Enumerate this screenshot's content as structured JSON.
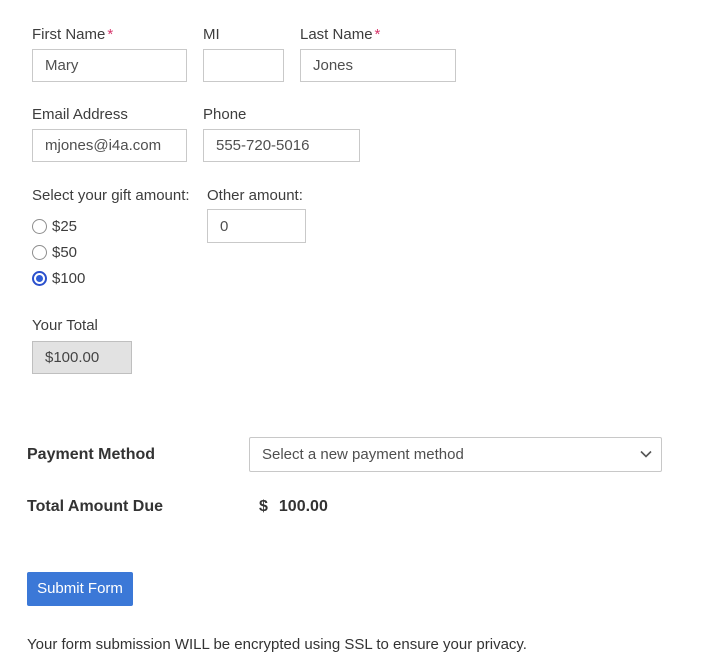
{
  "form": {
    "fields": {
      "first_name": {
        "label": "First Name",
        "required_marker": "*",
        "value": "Mary"
      },
      "mi": {
        "label": "MI",
        "value": ""
      },
      "last_name": {
        "label": "Last Name",
        "required_marker": "*",
        "value": "Jones"
      },
      "email": {
        "label": "Email Address",
        "value": "mjones@i4a.com"
      },
      "phone": {
        "label": "Phone",
        "value": "555-720-5016"
      }
    },
    "gift": {
      "label": "Select your gift amount:",
      "options": [
        {
          "label": "$25",
          "selected": false
        },
        {
          "label": "$50",
          "selected": false
        },
        {
          "label": "$100",
          "selected": true
        }
      ],
      "other": {
        "label": "Other amount:",
        "value": "0"
      }
    },
    "total": {
      "label": "Your Total",
      "value": "$100.00"
    },
    "payment": {
      "method_label": "Payment Method",
      "method_selected_option": "Select a new payment method",
      "due_label": "Total Amount Due",
      "due_currency": "$",
      "due_amount": "100.00"
    },
    "submit_label": "Submit Form",
    "privacy_note": "Your form submission WILL be encrypted using SSL to ensure your privacy."
  },
  "colors": {
    "accent_blue": "#3b78d7",
    "radio_blue": "#2e5cd6",
    "required_red": "#d6356b",
    "disabled_field_bg": "#e2e2e2"
  },
  "icons": {
    "select_chevron": "chevron-down"
  }
}
